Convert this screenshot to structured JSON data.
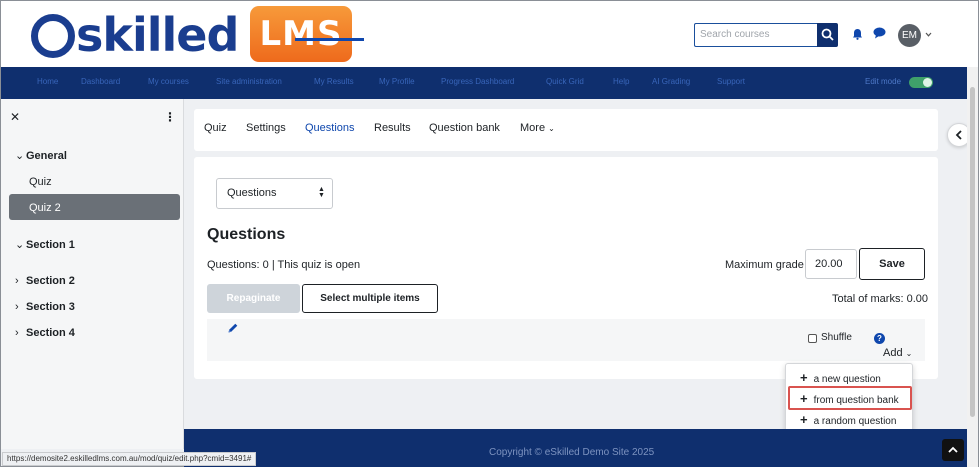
{
  "brand": {
    "logo_text": "skilled",
    "logo_badge": "LMS",
    "primary_color": "#1a3d8f",
    "accent_color": "#ee6a1c"
  },
  "header": {
    "search_placeholder": "Search courses",
    "avatar_initials": "EM",
    "nav_items": [
      "Home",
      "Dashboard",
      "My courses",
      "Site administration",
      "My Results",
      "My Profile",
      "Progress Dashboard",
      "Quick Grid",
      "Help",
      "AI Grading",
      "Support"
    ],
    "edit_mode_label": "Edit mode"
  },
  "sidebar": {
    "sections": [
      {
        "label": "General",
        "expanded": true,
        "items": [
          "Quiz",
          "Quiz 2"
        ]
      },
      {
        "label": "Section 1",
        "expanded": true,
        "items": []
      },
      {
        "label": "Section 2",
        "expanded": false,
        "items": []
      },
      {
        "label": "Section 3",
        "expanded": false,
        "items": []
      },
      {
        "label": "Section 4",
        "expanded": false,
        "items": []
      }
    ],
    "active_item": "Quiz 2"
  },
  "tabs": [
    "Quiz",
    "Settings",
    "Questions",
    "Results",
    "Question bank",
    "More"
  ],
  "active_tab": "Questions",
  "main": {
    "select_value": "Questions",
    "heading": "Questions",
    "status": "Questions: 0 | This quiz is open",
    "max_grade_label": "Maximum grade",
    "max_grade_value": "20.00",
    "save_label": "Save",
    "repaginate_label": "Repaginate",
    "select_multiple_label": "Select multiple items",
    "total_marks": "Total of marks: 0.00",
    "shuffle_label": "Shuffle",
    "add_label": "Add"
  },
  "add_menu": {
    "items": [
      "a new question",
      "from question bank",
      "a random question"
    ],
    "highlighted": "from question bank"
  },
  "footer": {
    "copyright": "Copyright © eSkilled Demo Site 2025"
  },
  "status_bar": {
    "url": "https://demosite2.eskilledlms.com.au/mod/quiz/edit.php?cmid=3491#"
  }
}
